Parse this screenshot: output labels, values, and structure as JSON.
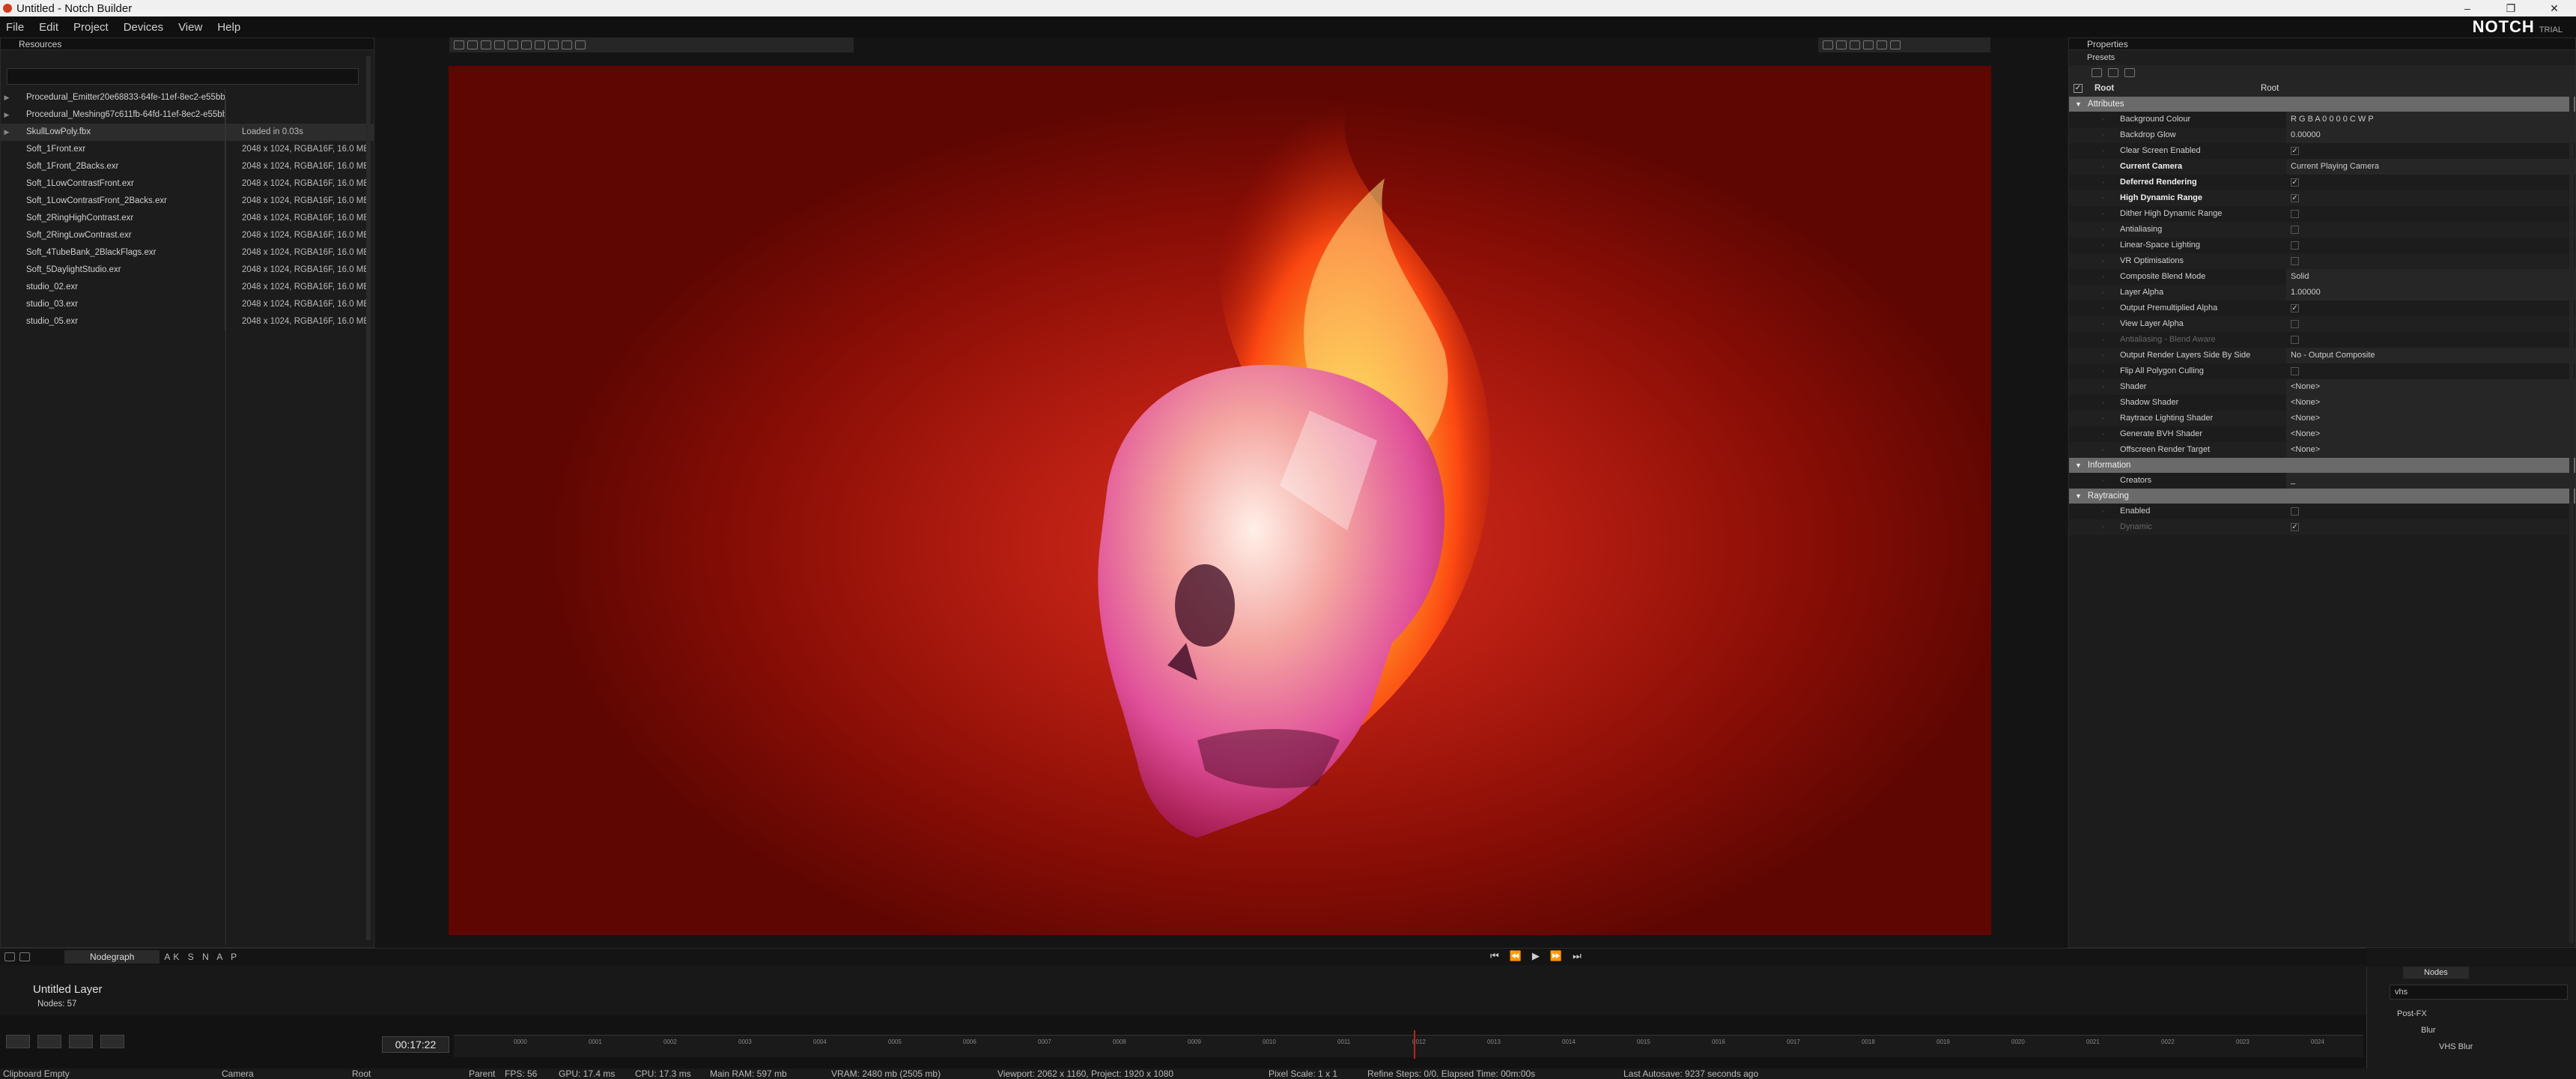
{
  "window": {
    "title": "Untitled - Notch Builder",
    "controls": [
      "–",
      "❐",
      "✕"
    ]
  },
  "menu": {
    "items": [
      "File",
      "Edit",
      "Project",
      "Devices",
      "View",
      "Help"
    ],
    "brand": "NOTCH",
    "trial": "TRIAL"
  },
  "resources": {
    "title": "Resources",
    "rows": [
      {
        "name": "Procedural_Emitter20e68833-64fe-11ef-8ec2-e55bb",
        "info": ""
      },
      {
        "name": "Procedural_Meshing67c611fb-64fd-11ef-8ec2-e55bb",
        "info": ""
      },
      {
        "name": "SkullLowPoly.fbx",
        "info": "Loaded in 0.03s"
      },
      {
        "name": "Soft_1Front.exr",
        "info": "2048 x 1024, RGBA16F, 16.0 MB"
      },
      {
        "name": "Soft_1Front_2Backs.exr",
        "info": "2048 x 1024, RGBA16F, 16.0 MB"
      },
      {
        "name": "Soft_1LowContrastFront.exr",
        "info": "2048 x 1024, RGBA16F, 16.0 MB"
      },
      {
        "name": "Soft_1LowContrastFront_2Backs.exr",
        "info": "2048 x 1024, RGBA16F, 16.0 MB"
      },
      {
        "name": "Soft_2RingHighContrast.exr",
        "info": "2048 x 1024, RGBA16F, 16.0 MB"
      },
      {
        "name": "Soft_2RingLowContrast.exr",
        "info": "2048 x 1024, RGBA16F, 16.0 MB"
      },
      {
        "name": "Soft_4TubeBank_2BlackFlags.exr",
        "info": "2048 x 1024, RGBA16F, 16.0 MB"
      },
      {
        "name": "Soft_5DaylightStudio.exr",
        "info": "2048 x 1024, RGBA16F, 16.0 MB"
      },
      {
        "name": "studio_02.exr",
        "info": "2048 x 1024, RGBA16F, 16.0 MB"
      },
      {
        "name": "studio_03.exr",
        "info": "2048 x 1024, RGBA16F, 16.0 MB"
      },
      {
        "name": "studio_05.exr",
        "info": "2048 x 1024, RGBA16F, 16.0 MB"
      }
    ]
  },
  "properties": {
    "title": "Properties",
    "presets": "Presets",
    "root": {
      "name": "Root",
      "value": "Root"
    },
    "sections": [
      {
        "title": "Attributes",
        "rows": [
          {
            "name": "Background Colour",
            "value": "R G B A  0  0  0  0        C   W   P",
            "style": ""
          },
          {
            "name": "Backdrop Glow",
            "value": "0.00000",
            "style": ""
          },
          {
            "name": "Clear Screen Enabled",
            "value": "✓",
            "style": ""
          },
          {
            "name": "Current Camera",
            "value": "Current Playing Camera",
            "style": "bold"
          },
          {
            "name": "Deferred Rendering",
            "value": "✓",
            "style": "bold"
          },
          {
            "name": "High Dynamic Range",
            "value": "✓",
            "style": "bold"
          },
          {
            "name": "Dither High Dynamic Range",
            "value": "",
            "style": ""
          },
          {
            "name": "Antialiasing",
            "value": "",
            "style": ""
          },
          {
            "name": "Linear-Space Lighting",
            "value": "",
            "style": ""
          },
          {
            "name": "VR Optimisations",
            "value": "",
            "style": ""
          },
          {
            "name": "Composite Blend Mode",
            "value": "Solid",
            "style": ""
          },
          {
            "name": "Layer Alpha",
            "value": "1.00000",
            "style": ""
          },
          {
            "name": "Output Premultiplied Alpha",
            "value": "✓",
            "style": ""
          },
          {
            "name": "View Layer Alpha",
            "value": "",
            "style": ""
          },
          {
            "name": "Antialiasing - Blend Aware",
            "value": "",
            "style": "dim"
          },
          {
            "name": "Output Render Layers Side By Side",
            "value": "No - Output Composite",
            "style": ""
          },
          {
            "name": "Flip All Polygon Culling",
            "value": "",
            "style": ""
          },
          {
            "name": "Shader",
            "value": "<None>",
            "style": ""
          },
          {
            "name": "Shadow Shader",
            "value": "<None>",
            "style": ""
          },
          {
            "name": "Raytrace Lighting Shader",
            "value": "<None>",
            "style": ""
          },
          {
            "name": "Generate BVH Shader",
            "value": "<None>",
            "style": ""
          },
          {
            "name": "Offscreen Render Target",
            "value": "<None>",
            "style": ""
          }
        ]
      },
      {
        "title": "Information",
        "rows": [
          {
            "name": "Creators",
            "value": "_",
            "style": ""
          }
        ]
      },
      {
        "title": "Raytracing",
        "rows": [
          {
            "name": "Enabled",
            "value": "",
            "style": ""
          },
          {
            "name": "Dynamic",
            "value": "✓",
            "style": "dim"
          }
        ]
      }
    ]
  },
  "nodegraph": {
    "tab": "Nodegraph",
    "letters": "AK S N A P",
    "layer_title": "Untitled  Layer",
    "nodes_label": "Nodes:  57"
  },
  "nodes_panel": {
    "tab": "Nodes",
    "search_value": "vhs",
    "tree": [
      "Post-FX",
      "Blur",
      "VHS Blur"
    ]
  },
  "timeline": {
    "time": "00:17:22",
    "ticks": [
      "0000",
      "0001",
      "0002",
      "0003",
      "0004",
      "0005",
      "0006",
      "0007",
      "0008",
      "0009",
      "0010",
      "0011",
      "0012",
      "0013",
      "0014",
      "0015",
      "0016",
      "0017",
      "0018",
      "0019",
      "0020",
      "0021",
      "0022",
      "0023",
      "0024"
    ]
  },
  "status": {
    "clipboard": "Clipboard Empty",
    "camera": "Camera",
    "root": "Root",
    "parent": "Parent",
    "fps": "FPS: 56",
    "gpu": "GPU: 17.4 ms",
    "cpu": "CPU: 17.3 ms",
    "ram": "Main RAM: 597 mb",
    "vram": "VRAM: 2480 mb (2505 mb)",
    "viewport": "Viewport: 2062 x 1160, Project: 1920 x 1080",
    "pixel_scale": "Pixel Scale: 1 x 1",
    "refine": "Refine Steps: 0/0. Elapsed Time: 00m:00s",
    "autosave": "Last Autosave: 9237 seconds ago"
  },
  "colors": {
    "accent": "#d23a1e",
    "background": "#161616",
    "viewport_red": "#b81e12"
  }
}
